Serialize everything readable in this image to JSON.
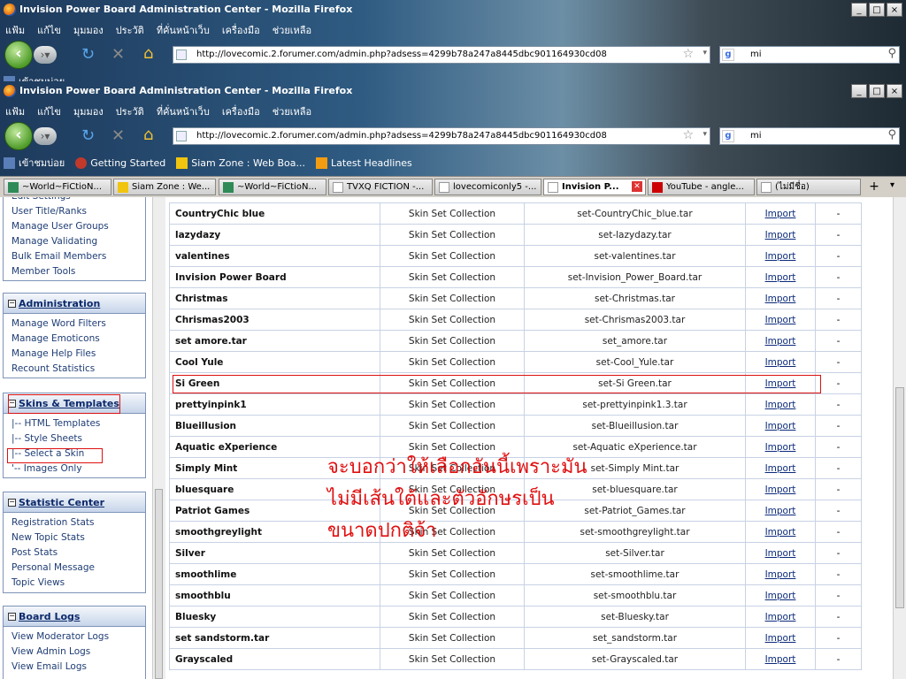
{
  "window": {
    "title": "Invision Power Board Administration Center - Mozilla Firefox",
    "minimize": "_",
    "maximize": "□",
    "close": "×"
  },
  "menus": [
    "แฟ้ม",
    "แก้ไข",
    "มุมมอง",
    "ประวัติ",
    "ที่คั่นหน้าเว็บ",
    "เครื่องมือ",
    "ช่วยเหลือ"
  ],
  "nav": {
    "url": "http://lovecomic.2.forumer.com/admin.php?adsess=4299b78a247a8445dbc901164930cd08",
    "search_value": "mi"
  },
  "bookmarks": [
    "เข้าชมบ่อย",
    "Getting Started",
    "Siam Zone : Web Boa...",
    "Latest Headlines"
  ],
  "tabs": [
    {
      "label": "~World~FiCtioN...",
      "active": false
    },
    {
      "label": "Siam Zone : We...",
      "active": false
    },
    {
      "label": "~World~FiCtioN...",
      "active": false
    },
    {
      "label": "TVXQ FICTION -...",
      "active": false
    },
    {
      "label": "lovecomiconly5 -...",
      "active": false
    },
    {
      "label": "Invision P...",
      "active": true
    },
    {
      "label": "YouTube - angle...",
      "active": false
    },
    {
      "label": "(ไม่มีชื่อ)",
      "active": false
    }
  ],
  "sidebar": {
    "top_partial": [
      "Edit Settings",
      "User Title/Ranks",
      "Manage User Groups",
      "Manage Validating",
      "Bulk Email Members",
      "Member Tools"
    ],
    "sections": [
      {
        "title": "Administration",
        "links": [
          "Manage Word Filters",
          "Manage Emoticons",
          "Manage Help Files",
          "Recount Statistics"
        ]
      },
      {
        "title": "Skins & Templates",
        "links": [
          "|-- HTML Templates",
          "|-- Style Sheets",
          "|-- Select a Skin",
          "'-- Images Only"
        ]
      },
      {
        "title": "Statistic Center",
        "links": [
          "Registration Stats",
          "New Topic Stats",
          "Post Stats",
          "Personal Message",
          "Topic Views"
        ]
      },
      {
        "title": "Board Logs",
        "links": [
          "View Moderator Logs",
          "View Admin Logs",
          "View Email Logs"
        ]
      }
    ]
  },
  "table": {
    "import_label": "Import",
    "rows": [
      [
        "CountryChic blue",
        "Skin Set Collection",
        "set-CountryChic_blue.tar",
        "-"
      ],
      [
        "lazydazy",
        "Skin Set Collection",
        "set-lazydazy.tar",
        "-"
      ],
      [
        "valentines",
        "Skin Set Collection",
        "set-valentines.tar",
        "-"
      ],
      [
        "Invision Power Board",
        "Skin Set Collection",
        "set-Invision_Power_Board.tar",
        "-"
      ],
      [
        "Christmas",
        "Skin Set Collection",
        "set-Christmas.tar",
        "-"
      ],
      [
        "Chrismas2003",
        "Skin Set Collection",
        "set-Chrismas2003.tar",
        "-"
      ],
      [
        "set amore.tar",
        "Skin Set Collection",
        "set_amore.tar",
        "-"
      ],
      [
        "Cool Yule",
        "Skin Set Collection",
        "set-Cool_Yule.tar",
        "-"
      ],
      [
        "Si Green",
        "Skin Set Collection",
        "set-Si Green.tar",
        "-"
      ],
      [
        "prettyinpink1",
        "Skin Set Collection",
        "set-prettyinpink1.3.tar",
        "-"
      ],
      [
        "Blueillusion",
        "Skin Set Collection",
        "set-Blueillusion.tar",
        "-"
      ],
      [
        "Aquatic eXperience",
        "Skin Set Collection",
        "set-Aquatic eXperience.tar",
        "-"
      ],
      [
        "Simply Mint",
        "Skin Set Collection",
        "set-Simply Mint.tar",
        "-"
      ],
      [
        "bluesquare",
        "Skin Set Collection",
        "set-bluesquare.tar",
        "-"
      ],
      [
        "Patriot Games",
        "Skin Set Collection",
        "set-Patriot_Games.tar",
        "-"
      ],
      [
        "smoothgreylight",
        "Skin Set Collection",
        "set-smoothgreylight.tar",
        "-"
      ],
      [
        "Silver",
        "Skin Set Collection",
        "set-Silver.tar",
        "-"
      ],
      [
        "smoothlime",
        "Skin Set Collection",
        "set-smoothlime.tar",
        "-"
      ],
      [
        "smoothblu",
        "Skin Set Collection",
        "set-smoothblu.tar",
        "-"
      ],
      [
        "Bluesky",
        "Skin Set Collection",
        "set-Bluesky.tar",
        "-"
      ],
      [
        "set sandstorm.tar",
        "Skin Set Collection",
        "set_sandstorm.tar",
        "-"
      ],
      [
        "Grayscaled",
        "Skin Set Collection",
        "set-Grayscaled.tar",
        "-"
      ]
    ]
  },
  "annotation": [
    "จะบอกว่าให้เลือกอันนี้เพราะมัน",
    "ไม่มีเส้นใต้และตัวอักษรเป็น",
    "ขนาดปกติจ้า"
  ],
  "colors": {
    "accent": "#0d2a6b",
    "annotation": "#e01010",
    "highlight_box": "#d11111"
  }
}
